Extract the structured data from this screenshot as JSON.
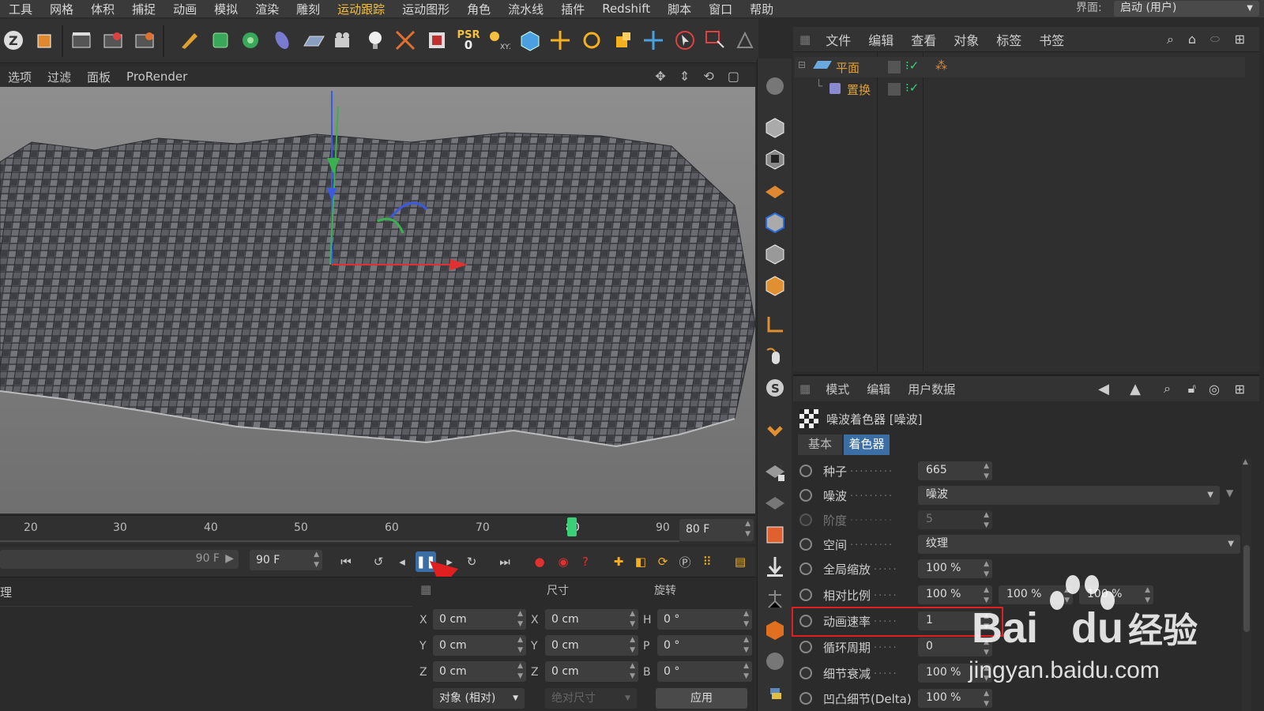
{
  "menubar": {
    "items": [
      "工具",
      "网格",
      "体积",
      "捕捉",
      "动画",
      "模拟",
      "渲染",
      "雕刻",
      "运动跟踪",
      "运动图形",
      "角色",
      "流水线",
      "插件",
      "Redshift",
      "脚本",
      "窗口",
      "帮助"
    ],
    "layout_label": "界面:",
    "layout_value": "启动 (用户)"
  },
  "toolbar": {
    "psr_label": "PSR",
    "psr_value": "0"
  },
  "viewport": {
    "menu": [
      "选项",
      "过滤",
      "面板",
      "ProRender"
    ]
  },
  "timeline": {
    "ticks": [
      "20",
      "30",
      "40",
      "50",
      "60",
      "70",
      "80",
      "90"
    ],
    "current_frame": "80 F"
  },
  "playback": {
    "end_a": "90 F",
    "end_b": "90 F"
  },
  "lower_left": {
    "label": "理"
  },
  "coords": {
    "headers": {
      "size": "尺寸",
      "rotation": "旋转"
    },
    "rows": [
      {
        "pos_axis": "X",
        "pos": "0 cm",
        "size_axis": "X",
        "size": "0 cm",
        "rot_axis": "H",
        "rot": "0 °"
      },
      {
        "pos_axis": "Y",
        "pos": "0 cm",
        "size_axis": "Y",
        "size": "0 cm",
        "rot_axis": "P",
        "rot": "0 °"
      },
      {
        "pos_axis": "Z",
        "pos": "0 cm",
        "size_axis": "Z",
        "size": "0 cm",
        "rot_axis": "B",
        "rot": "0 °"
      }
    ],
    "mode": "对象 (相对)",
    "size_mode": "绝对尺寸",
    "apply": "应用"
  },
  "object_manager": {
    "menu": [
      "文件",
      "编辑",
      "查看",
      "对象",
      "标签",
      "书签"
    ],
    "objects": [
      {
        "name": "平面"
      },
      {
        "name": "置换"
      }
    ]
  },
  "attributes": {
    "menu": [
      "模式",
      "编辑",
      "用户数据"
    ],
    "title": "噪波着色器 [噪波]",
    "tabs": [
      "基本",
      "着色器"
    ],
    "params": [
      {
        "label": "种子",
        "value": "665"
      },
      {
        "label": "噪波",
        "value": "噪波"
      },
      {
        "label": "阶度",
        "value": "5"
      },
      {
        "label": "空间",
        "value": "纹理"
      },
      {
        "label": "全局缩放",
        "value": "100 %"
      },
      {
        "label": "相对比例",
        "value": "100 %",
        "value2": "100 %",
        "value3": "100 %"
      },
      {
        "label": "动画速率",
        "value": "1"
      },
      {
        "label": "循环周期",
        "value": "0"
      },
      {
        "label": "细节衰减",
        "value": "100 %"
      },
      {
        "label": "凹凸细节(Delta)",
        "value": "100 %"
      }
    ]
  },
  "watermark": {
    "brand_a": "Bai",
    "brand_b": "du",
    "brand_c": "经验",
    "url": "jingyan.baidu.com"
  },
  "colors": {
    "highlight": "#e02020",
    "accent": "#f5c040",
    "active_tab": "#3a6ea5"
  }
}
